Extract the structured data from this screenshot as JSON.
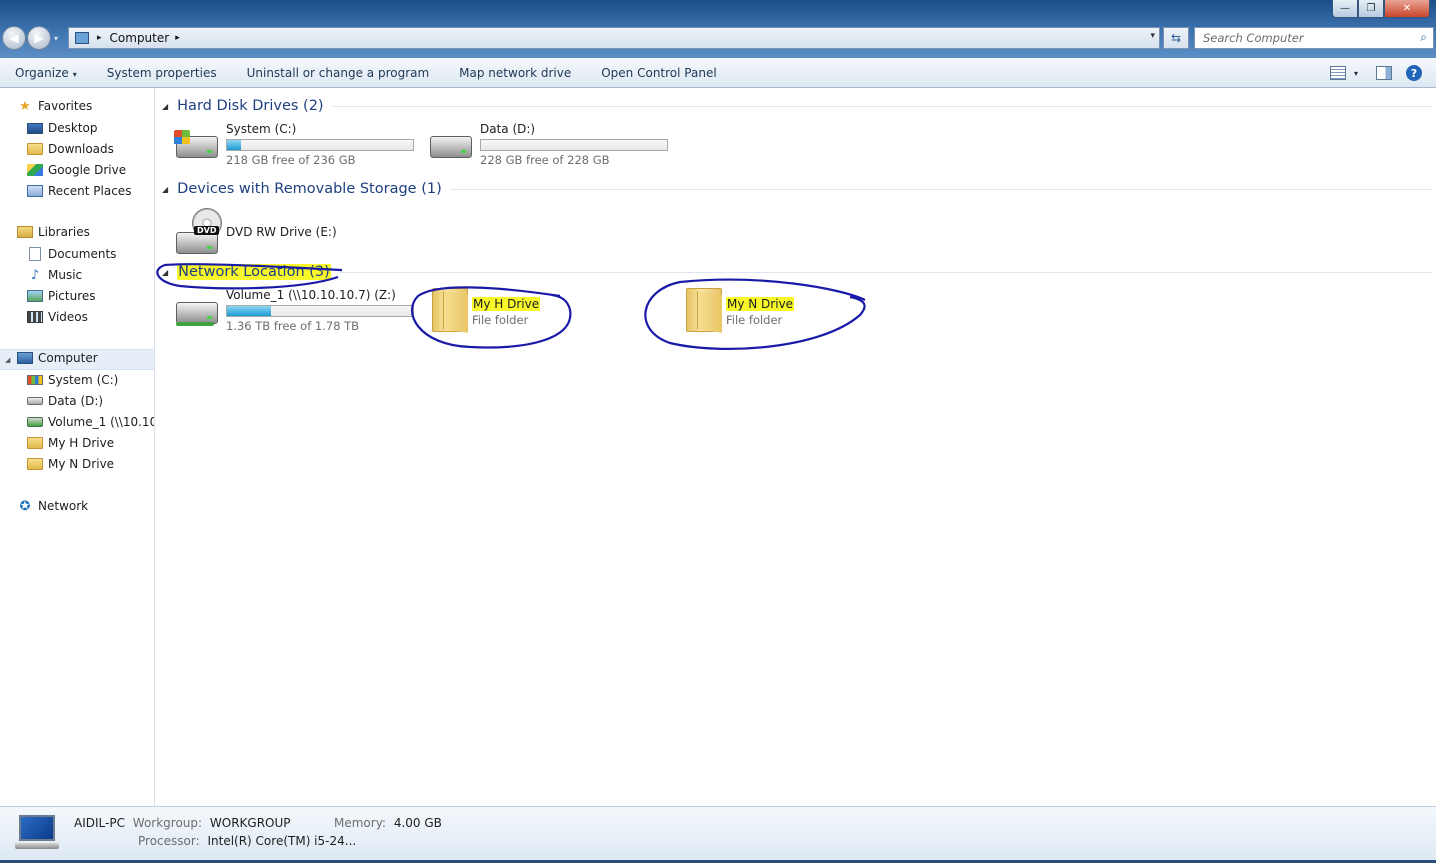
{
  "window": {
    "minimize_glyph": "—",
    "maximize_glyph": "❐",
    "close_glyph": "✕"
  },
  "nav": {
    "back_glyph": "◀",
    "forward_glyph": "▶",
    "history_glyph": "▾"
  },
  "address": {
    "crumb": "Computer",
    "separator_glyph": "▸",
    "dropdown_glyph": "▾",
    "refresh_glyph": "⇆"
  },
  "search": {
    "placeholder": "Search Computer",
    "icon_glyph": "⌕"
  },
  "toolbar": {
    "organize": "Organize",
    "caret": "▾",
    "system_properties": "System properties",
    "uninstall": "Uninstall or change a program",
    "map_drive": "Map network drive",
    "control_panel": "Open Control Panel",
    "help_glyph": "?"
  },
  "sidebar": {
    "favorites": "Favorites",
    "favorites_items": [
      "Desktop",
      "Downloads",
      "Google Drive",
      "Recent Places"
    ],
    "libraries": "Libraries",
    "libraries_items": [
      "Documents",
      "Music",
      "Pictures",
      "Videos"
    ],
    "computer": "Computer",
    "computer_items": [
      "System (C:)",
      "Data (D:)",
      "Volume_1 (\\\\10.10.10.7) (Z:)",
      "My H Drive",
      "My N Drive"
    ],
    "network": "Network",
    "star_glyph": "★",
    "music_glyph": "♪",
    "network_glyph": "✪",
    "expander_glyph": "◢"
  },
  "groups": {
    "hard_disk": {
      "title": "Hard Disk Drives (2)",
      "items": [
        {
          "name": "System (C:)",
          "free": "218 GB free of 236 GB",
          "used_fraction": 0.076
        },
        {
          "name": "Data (D:)",
          "free": "228 GB free of 228 GB",
          "used_fraction": 0.0
        }
      ]
    },
    "removable": {
      "title": "Devices with Removable Storage (1)",
      "items": [
        {
          "name": "DVD RW Drive (E:)",
          "label": "DVD"
        }
      ]
    },
    "network": {
      "title": "Network Location (3)",
      "items": [
        {
          "name": "Volume_1 (\\\\10.10.10.7) (Z:)",
          "free": "1.36 TB free of 1.78 TB",
          "used_fraction": 0.236
        },
        {
          "name": "My H Drive",
          "type": "File folder"
        },
        {
          "name": "My N Drive",
          "type": "File folder"
        }
      ]
    },
    "collapse_glyph": "◢"
  },
  "details": {
    "pc_name": "AIDIL-PC",
    "workgroup_label": "Workgroup:",
    "workgroup": "WORKGROUP",
    "memory_label": "Memory:",
    "memory": "4.00 GB",
    "processor_label": "Processor:",
    "processor": "Intel(R) Core(TM) i5-24..."
  },
  "colors": {
    "annotation": "#1a1aa8",
    "highlight": "#f7f72a",
    "group_title": "#1e3f80"
  }
}
